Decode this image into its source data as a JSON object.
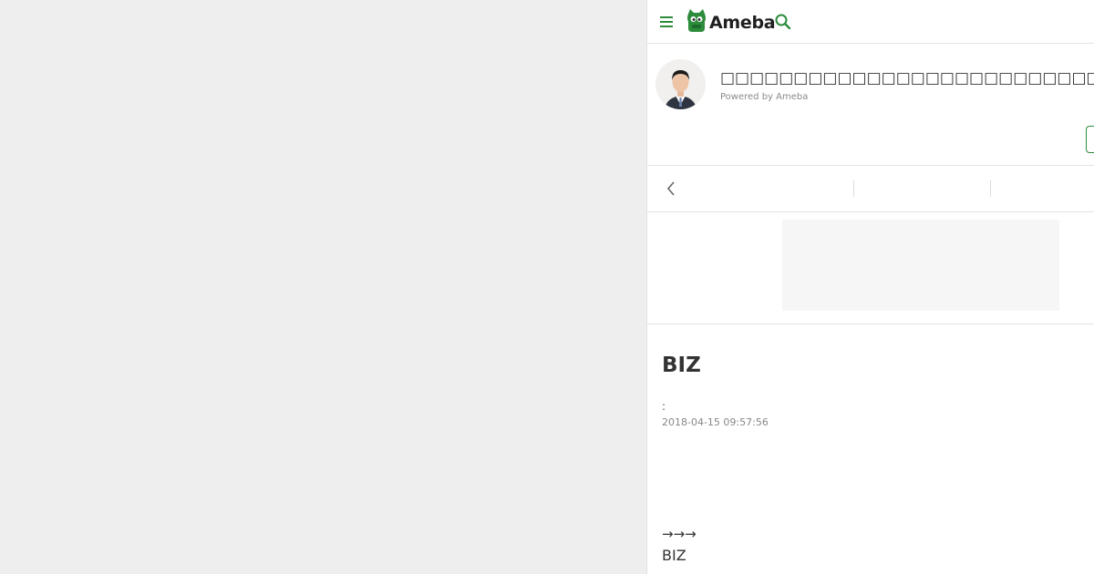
{
  "header": {
    "logo_text": "Ameba",
    "brand_color": "#2d8c3c",
    "menu_icon": "hamburger-menu-icon",
    "search_icon": "search-icon"
  },
  "profile": {
    "blog_title": "□□□□□□□□□□□□□□□□□□□□□□□□□□□□□□□□□□□□□",
    "powered_by": "Powered by Ameba"
  },
  "nav": {
    "back_icon": "chevron-left-icon"
  },
  "article": {
    "title": "BIZ",
    "theme_label": ":",
    "date": "2018-04-15 09:57:56",
    "arrows": "→→→",
    "body_text": "BIZ"
  }
}
